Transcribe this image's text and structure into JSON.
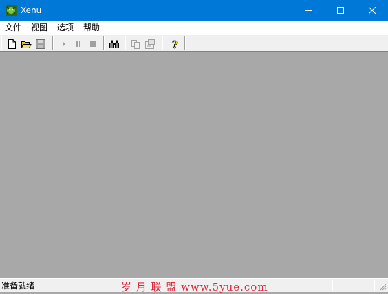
{
  "window": {
    "title": "Xenu",
    "app_icon": "xenu-bug-icon",
    "controls": [
      "minimize-icon",
      "maximize-icon",
      "close-icon"
    ],
    "titlebar_color": "#0078d7"
  },
  "menu": {
    "items": [
      {
        "label": "文件"
      },
      {
        "label": "视图"
      },
      {
        "label": "选项"
      },
      {
        "label": "帮助"
      }
    ]
  },
  "toolbar": {
    "groups": [
      [
        "new-document-icon",
        "open-folder-icon",
        "save-disk-icon"
      ],
      [
        "play-icon",
        "pause-icon",
        "stop-icon"
      ],
      [
        "find-binoculars-icon"
      ],
      [
        "copy-icon",
        "properties-icon"
      ],
      [
        "help-icon"
      ]
    ]
  },
  "client": {
    "background": "#a8a8a8"
  },
  "status": {
    "text": "准备就绪",
    "watermark": "岁 月 联 盟   www.5yue.com"
  }
}
